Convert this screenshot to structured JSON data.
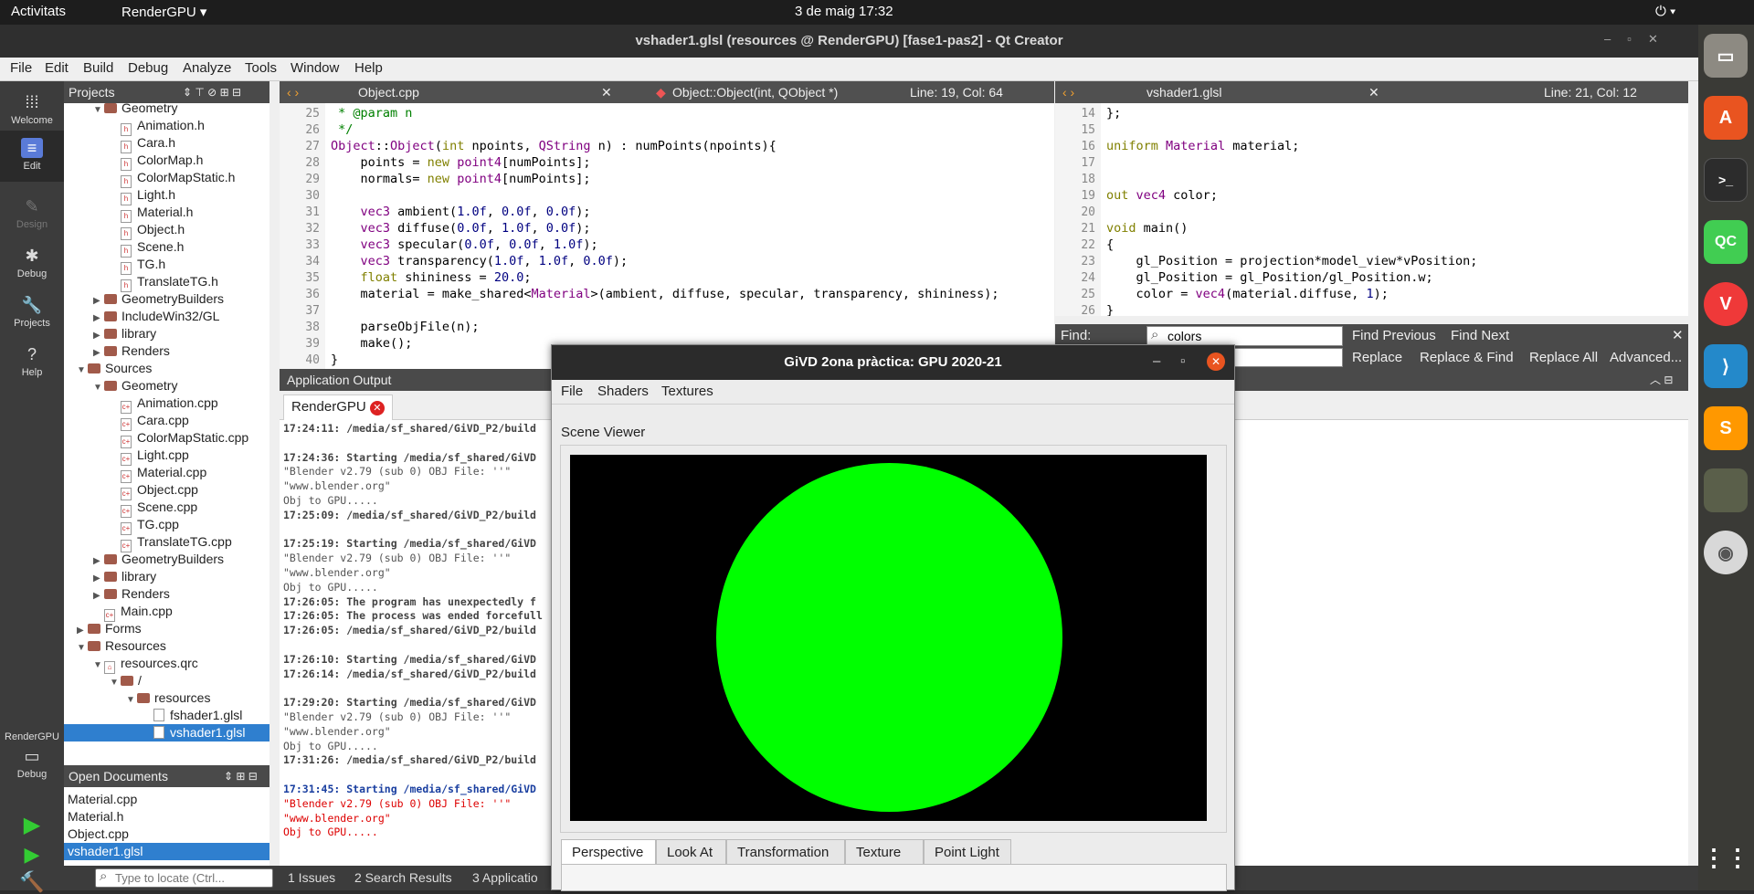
{
  "topbar": {
    "activities": "Activitats",
    "app": "RenderGPU ▾",
    "datetime": "3 de maig  17:32"
  },
  "window": {
    "title": "vshader1.glsl (resources @ RenderGPU) [fase1-pas2] - Qt Creator"
  },
  "menu": [
    "File",
    "Edit",
    "Build",
    "Debug",
    "Analyze",
    "Tools",
    "Window",
    "Help"
  ],
  "modes": [
    "Welcome",
    "Edit",
    "Design",
    "Debug",
    "Projects",
    "Help"
  ],
  "kit": {
    "project": "RenderGPU",
    "config": "Debug"
  },
  "projects": {
    "header": "Projects",
    "rows": [
      {
        "t": "Geometry",
        "k": "folder",
        "d": 2,
        "a": "▼"
      },
      {
        "t": "Animation.h",
        "k": "h",
        "d": 3
      },
      {
        "t": "Cara.h",
        "k": "h",
        "d": 3
      },
      {
        "t": "ColorMap.h",
        "k": "h",
        "d": 3
      },
      {
        "t": "ColorMapStatic.h",
        "k": "h",
        "d": 3
      },
      {
        "t": "Light.h",
        "k": "h",
        "d": 3
      },
      {
        "t": "Material.h",
        "k": "h",
        "d": 3
      },
      {
        "t": "Object.h",
        "k": "h",
        "d": 3
      },
      {
        "t": "Scene.h",
        "k": "h",
        "d": 3
      },
      {
        "t": "TG.h",
        "k": "h",
        "d": 3
      },
      {
        "t": "TranslateTG.h",
        "k": "h",
        "d": 3
      },
      {
        "t": "GeometryBuilders",
        "k": "folder",
        "d": 2,
        "a": "▶"
      },
      {
        "t": "IncludeWin32/GL",
        "k": "folder",
        "d": 2,
        "a": "▶"
      },
      {
        "t": "library",
        "k": "folder",
        "d": 2,
        "a": "▶"
      },
      {
        "t": "Renders",
        "k": "folder",
        "d": 2,
        "a": "▶"
      },
      {
        "t": "Sources",
        "k": "folder",
        "d": 1,
        "a": "▼"
      },
      {
        "t": "Geometry",
        "k": "folder",
        "d": 2,
        "a": "▼"
      },
      {
        "t": "Animation.cpp",
        "k": "c",
        "d": 3
      },
      {
        "t": "Cara.cpp",
        "k": "c",
        "d": 3
      },
      {
        "t": "ColorMapStatic.cpp",
        "k": "c",
        "d": 3
      },
      {
        "t": "Light.cpp",
        "k": "c",
        "d": 3
      },
      {
        "t": "Material.cpp",
        "k": "c",
        "d": 3
      },
      {
        "t": "Object.cpp",
        "k": "c",
        "d": 3
      },
      {
        "t": "Scene.cpp",
        "k": "c",
        "d": 3
      },
      {
        "t": "TG.cpp",
        "k": "c",
        "d": 3
      },
      {
        "t": "TranslateTG.cpp",
        "k": "c",
        "d": 3
      },
      {
        "t": "GeometryBuilders",
        "k": "folder",
        "d": 2,
        "a": "▶"
      },
      {
        "t": "library",
        "k": "folder",
        "d": 2,
        "a": "▶"
      },
      {
        "t": "Renders",
        "k": "folder",
        "d": 2,
        "a": "▶"
      },
      {
        "t": "Main.cpp",
        "k": "c",
        "d": 2
      },
      {
        "t": "Forms",
        "k": "folder",
        "d": 1,
        "a": "▶"
      },
      {
        "t": "Resources",
        "k": "folder",
        "d": 1,
        "a": "▼"
      },
      {
        "t": "resources.qrc",
        "k": "q",
        "d": 2,
        "a": "▼"
      },
      {
        "t": "/",
        "k": "folder",
        "d": 3,
        "a": "▼"
      },
      {
        "t": "resources",
        "k": "folder",
        "d": 4,
        "a": "▼"
      },
      {
        "t": "fshader1.glsl",
        "k": "g",
        "d": 5
      },
      {
        "t": "vshader1.glsl",
        "k": "g",
        "d": 5,
        "sel": true
      }
    ]
  },
  "opendocs": {
    "header": "Open Documents",
    "items": [
      "Material.cpp",
      "Material.h",
      "Object.cpp",
      "vshader1.glsl"
    ],
    "selected": 3
  },
  "locator": {
    "placeholder": "Type to locate (Ctrl..."
  },
  "outtabs": [
    "1  Issues",
    "2  Search Results",
    "3  Applicatio"
  ],
  "editor1": {
    "file": "Object.cpp",
    "symbol": "Object::Object(int, QObject *)",
    "pos": "Line: 19, Col: 64",
    "first": 25,
    "lines": [
      " * @param n",
      " */",
      "Object::Object(int npoints, QString n) : numPoints(npoints){",
      "    points = new point4[numPoints];",
      "    normals= new point4[numPoints];",
      "",
      "    vec3 ambient(1.0f, 0.0f, 0.0f);",
      "    vec3 diffuse(0.0f, 1.0f, 0.0f);",
      "    vec3 specular(0.0f, 0.0f, 1.0f);",
      "    vec3 transparency(1.0f, 1.0f, 0.0f);",
      "    float shininess = 20.0;",
      "    material = make_shared<Material>(ambient, diffuse, specular, transparency, shininess);",
      "",
      "    parseObjFile(n);",
      "    make();",
      "}"
    ]
  },
  "editor2": {
    "file": "vshader1.glsl",
    "pos": "Line: 21, Col: 12",
    "first": 14,
    "lines": [
      "};",
      "",
      "uniform Material material;",
      "",
      "",
      "out vec4 color;",
      "",
      "void main()",
      "{",
      "    gl_Position = projection*model_view*vPosition;",
      "    gl_Position = gl_Position/gl_Position.w;",
      "    color = vec4(material.diffuse, 1);",
      "}"
    ]
  },
  "find": {
    "label": "Find:",
    "value": "colors",
    "find_prev": "Find Previous",
    "find_next": "Find Next",
    "replace": "Replace",
    "replace_find": "Replace & Find",
    "replace_all": "Replace All",
    "advanced": "Advanced..."
  },
  "output": {
    "header": "Application Output",
    "tab": "RenderGPU",
    "lines": [
      {
        "t": "17:24:11: /media/sf_shared/GiVD_P2/build",
        "b": 1
      },
      {
        "t": "",
        "b": 0
      },
      {
        "t": "17:24:36: Starting /media/sf_shared/GiVD",
        "b": 1
      },
      {
        "t": "\"Blender v2.79 (sub 0) OBJ File: ''\"",
        "b": 0
      },
      {
        "t": "\"www.blender.org\"",
        "b": 0
      },
      {
        "t": "Obj to GPU.....",
        "b": 0
      },
      {
        "t": "17:25:09: /media/sf_shared/GiVD_P2/build",
        "b": 1
      },
      {
        "t": "",
        "b": 0
      },
      {
        "t": "17:25:19: Starting /media/sf_shared/GiVD",
        "b": 1
      },
      {
        "t": "\"Blender v2.79 (sub 0) OBJ File: ''\"",
        "b": 0
      },
      {
        "t": "\"www.blender.org\"",
        "b": 0
      },
      {
        "t": "Obj to GPU.....",
        "b": 0
      },
      {
        "t": "17:26:05: The program has unexpectedly f",
        "b": 1
      },
      {
        "t": "17:26:05: The process was ended forcefull",
        "b": 1
      },
      {
        "t": "17:26:05: /media/sf_shared/GiVD_P2/build",
        "b": 1
      },
      {
        "t": "",
        "b": 0
      },
      {
        "t": "17:26:10: Starting /media/sf_shared/GiVD",
        "b": 1
      },
      {
        "t": "17:26:14: /media/sf_shared/GiVD_P2/build",
        "b": 1
      },
      {
        "t": "",
        "b": 0
      },
      {
        "t": "17:29:20: Starting /media/sf_shared/GiVD",
        "b": 1
      },
      {
        "t": "\"Blender v2.79 (sub 0) OBJ File: ''\"",
        "b": 0
      },
      {
        "t": "\"www.blender.org\"",
        "b": 0
      },
      {
        "t": "Obj to GPU.....",
        "b": 0
      },
      {
        "t": "17:31:26: /media/sf_shared/GiVD_P2/build",
        "b": 1
      },
      {
        "t": "",
        "b": 0
      },
      {
        "t": "17:31:45: Starting /media/sf_shared/GiVD",
        "b": 2
      },
      {
        "t": "\"Blender v2.79 (sub 0) OBJ File: ''\"",
        "b": 3
      },
      {
        "t": "\"www.blender.org\"",
        "b": 3
      },
      {
        "t": "Obj to GPU.....",
        "b": 3
      }
    ]
  },
  "dialog": {
    "title": "GiVD 2ona pràctica: GPU 2020-21",
    "menu": [
      "File",
      "Shaders",
      "Textures"
    ],
    "viewer_label": "Scene Viewer",
    "tabs": [
      "Perspective",
      "Look At",
      "Transformation",
      "Texture",
      "Point Light"
    ],
    "active_tab": 0,
    "sphere_color": "#00ff00",
    "bg_color": "#000000"
  }
}
